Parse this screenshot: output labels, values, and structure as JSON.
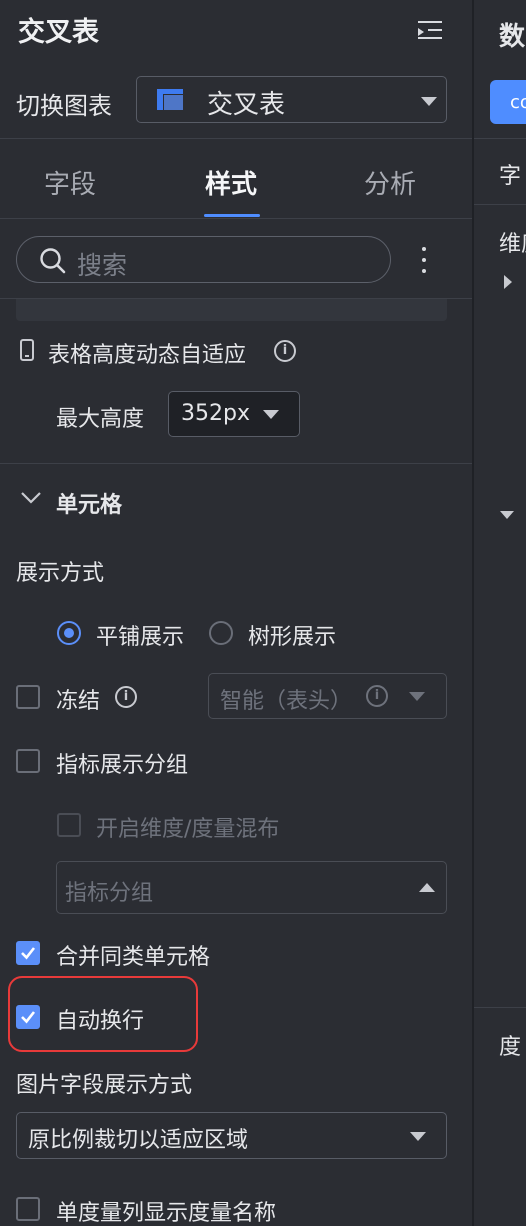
{
  "panel": {
    "title": "交叉表",
    "switch_chart_label": "切换图表",
    "chart_type_value": "交叉表",
    "tabs": [
      {
        "label": "字段"
      },
      {
        "label": "样式"
      },
      {
        "label": "分析"
      }
    ],
    "active_tab": "样式",
    "search_placeholder": "搜索"
  },
  "table_height": {
    "label": "表格高度动态自适应",
    "info_icon": "i",
    "max_height_label": "最大高度",
    "max_height_value": "352px"
  },
  "cell_section": {
    "title": "单元格",
    "display_mode_label": "展示方式",
    "display_options": [
      {
        "label": "平铺展示",
        "selected": true
      },
      {
        "label": "树形展示",
        "selected": false
      }
    ],
    "freeze_label": "冻结",
    "freeze_info_icon": "i",
    "freeze_select_value": "智能（表头）",
    "freeze_select_info_icon": "i",
    "metric_group_label": "指标展示分组",
    "mix_label": "开启维度/度量混布",
    "metric_group_placeholder": "指标分组",
    "merge_cells_label": "合并同类单元格",
    "auto_wrap_label": "自动换行",
    "image_field_label": "图片字段展示方式",
    "image_field_value": "原比例裁切以适应区域",
    "single_measure_label": "单度量列显示度量名称"
  },
  "right_panel": {
    "title_fragment": "数",
    "button_fragment": "co",
    "field_fragment": "字",
    "dimension_fragment": "维度",
    "measure_fragment": "度"
  },
  "colors": {
    "background": "#2b2d33",
    "accent": "#5b8ff9",
    "highlight": "#e83a3a"
  }
}
